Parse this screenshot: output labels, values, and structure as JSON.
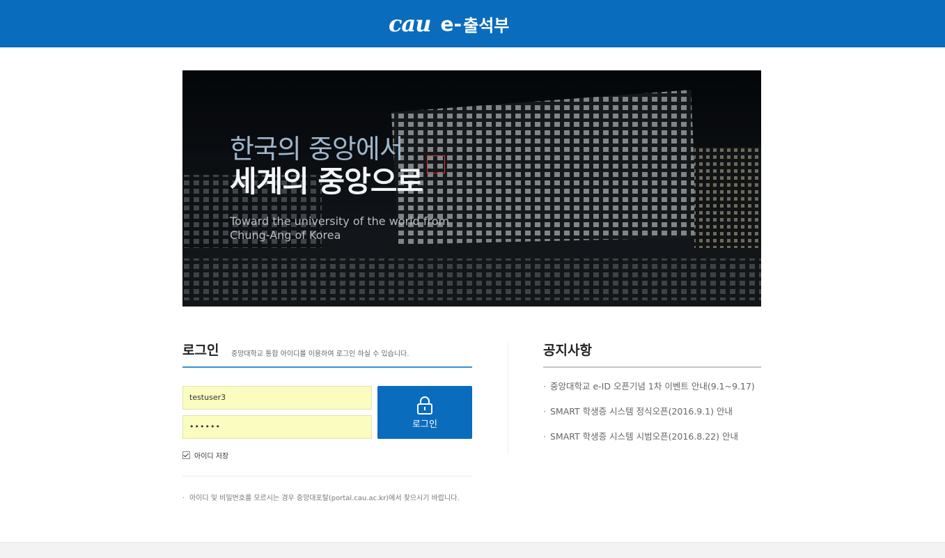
{
  "header": {
    "logo_text": "cau",
    "title_prefix": "e-",
    "title": "출석부",
    "bg_color": "#0a6cbd"
  },
  "hero": {
    "line1": "한국의 중앙에서",
    "line2": "세계의 중앙으로",
    "en_line1": "Toward the university of the world from",
    "en_line2": "Chung-Ang of Korea"
  },
  "login": {
    "title": "로그인",
    "description": "중앙대학교 통합 아이디를 이용하여 로그인 하실 수 있습니다.",
    "username_value": "testuser3",
    "password_value": "••••••",
    "button_label": "로그인",
    "button_icon": "lock-icon",
    "remember_label": "아이디 저장",
    "remember_checked": true,
    "help_bullet": "·",
    "help_text": "아이디 및 비밀번호를 모르시는 경우 중앙대포탈(portal.cau.ac.kr)에서 찾으시기 바랍니다."
  },
  "notice": {
    "title": "공지사항",
    "bullet": "·",
    "items": [
      {
        "label": "중앙대학교 e-ID 오픈기념 1차 이벤트 안내(9.1~9.17)"
      },
      {
        "label": "SMART 학생증 시스템 정식오픈(2016.9.1) 안내"
      },
      {
        "label": "SMART 학생증 시스템 시범오픈(2016.8.22) 안내"
      }
    ]
  }
}
